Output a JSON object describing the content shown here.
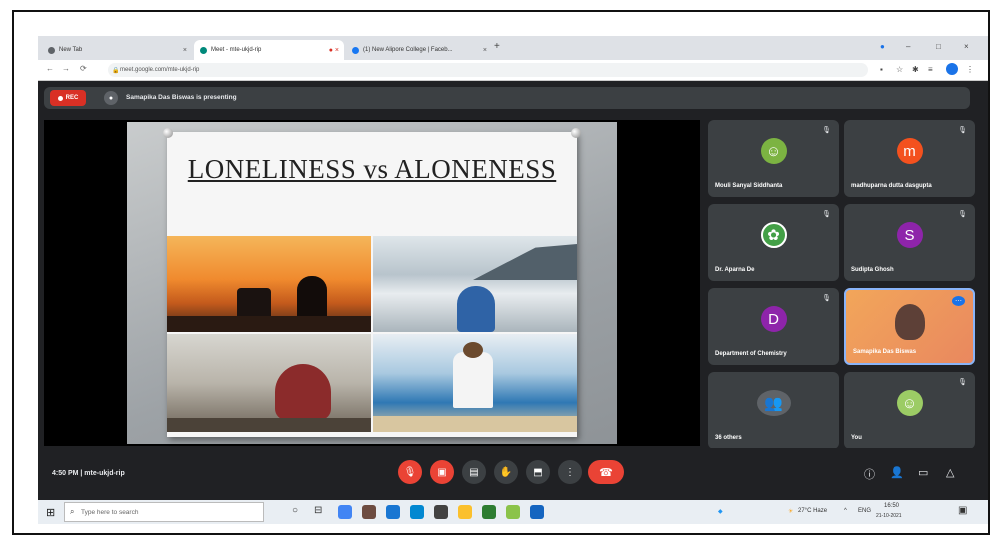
{
  "browser": {
    "tabs": [
      {
        "label": "New Tab",
        "favicon_color": "#5f6368",
        "active": false
      },
      {
        "label": "Meet - mte-ukjd-rip",
        "favicon_color": "#00897b",
        "active": true
      },
      {
        "label": "(1) New Alipore College | Faceb...",
        "favicon_color": "#1877f2",
        "active": false
      }
    ],
    "new_tab": "+",
    "window_controls": {
      "minimize": "–",
      "restore": "□",
      "close": "×"
    },
    "url": "meet.google.com/mte-ukjd-rip",
    "nav": {
      "back": "←",
      "forward": "→",
      "reload": "⟳"
    }
  },
  "meet": {
    "rec_label": "REC",
    "presenting_text": "Samapika Das Biswas is presenting",
    "slide": {
      "title": "LONELINESS vs ALONENESS"
    },
    "participants": [
      {
        "name": "Mouli Sanyal Siddhanta",
        "initial": "",
        "color": "#7cb342",
        "type": "photo"
      },
      {
        "name": "madhuparna dutta dasgupta",
        "initial": "m",
        "color": "#f4511e",
        "type": "initial"
      },
      {
        "name": "Dr. Aparna De",
        "initial": "",
        "color": "#43a047",
        "type": "logo"
      },
      {
        "name": "Sudipta Ghosh",
        "initial": "S",
        "color": "#8e24aa",
        "type": "initial"
      },
      {
        "name": "Department of Chemistry",
        "initial": "D",
        "color": "#8e24aa",
        "type": "initial"
      },
      {
        "name": "Samapika Das Biswas",
        "initial": "",
        "color": "#e9885f",
        "type": "speaking"
      },
      {
        "name": "36 others",
        "initial": "",
        "color": "#5f6368",
        "type": "group"
      },
      {
        "name": "You",
        "initial": "",
        "color": "#9ccc65",
        "type": "photo"
      }
    ],
    "meeting_info": "4:50 PM  |  mte-ukjd-rip"
  },
  "taskbar": {
    "search_placeholder": "Type here to search",
    "weather": "27°C Haze",
    "language": "ENG",
    "time": "16:50",
    "date": "21-10-2021"
  }
}
